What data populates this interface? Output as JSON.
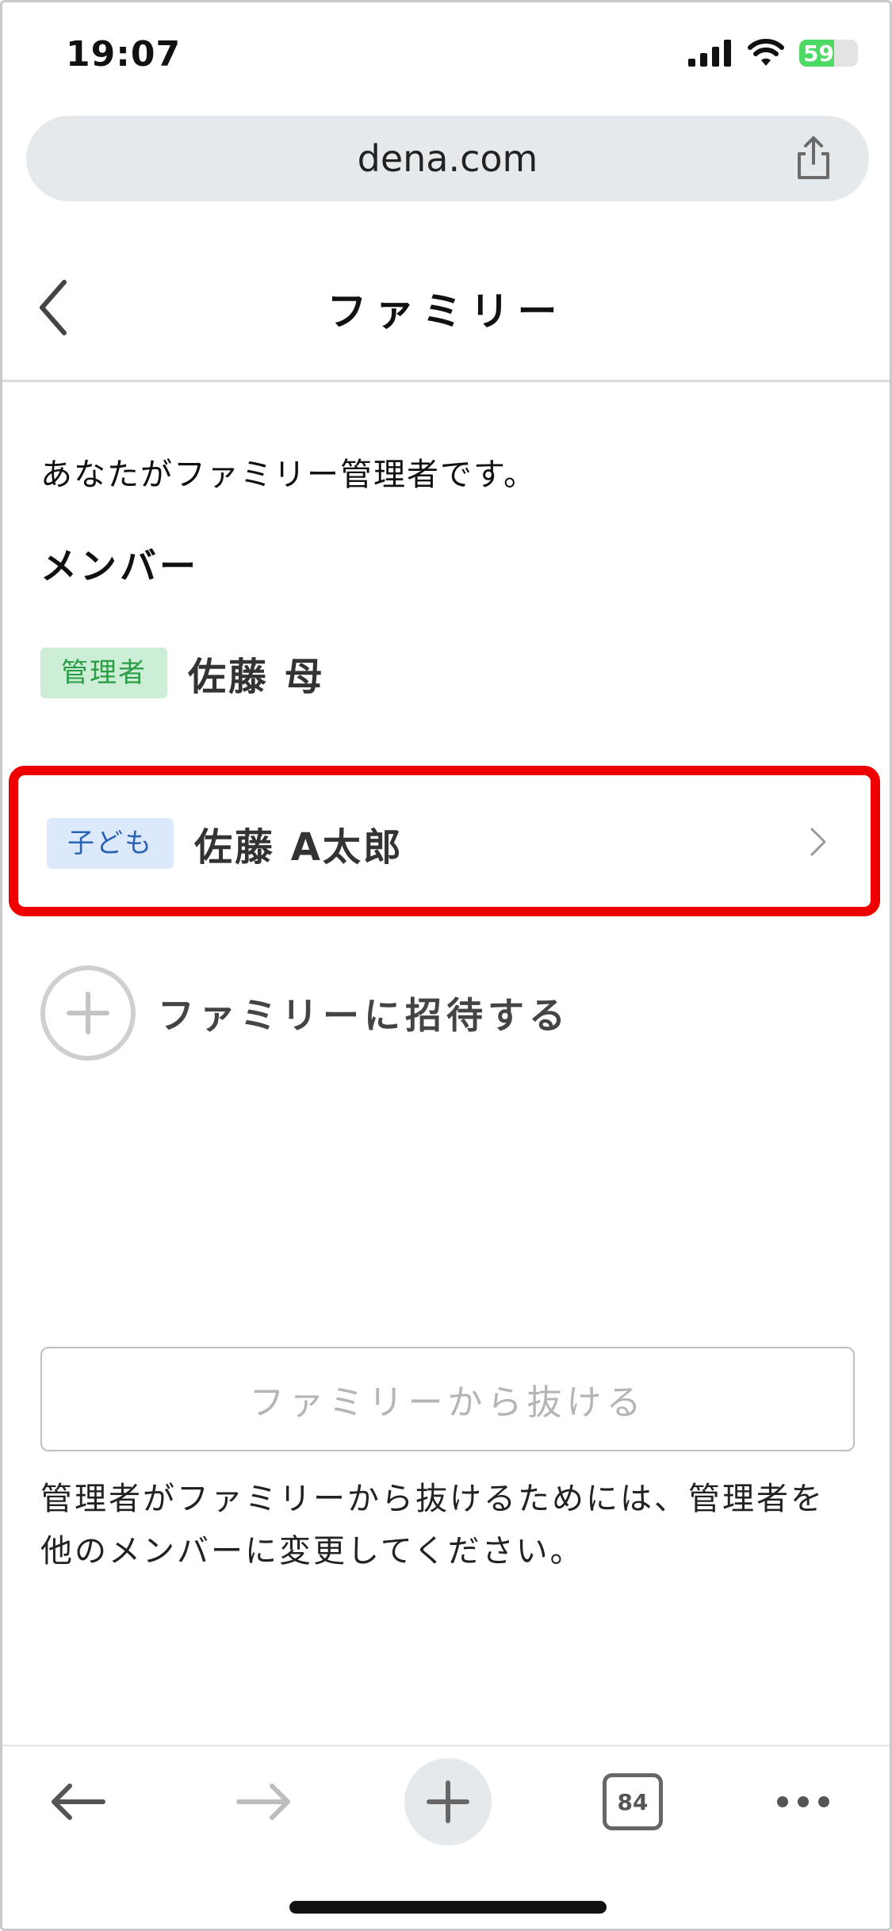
{
  "status_bar": {
    "time": "19:07",
    "battery": "59",
    "battery_level": 0.59
  },
  "browser": {
    "url": "dena.com",
    "tab_count": "84"
  },
  "header": {
    "title": "ファミリー"
  },
  "content": {
    "admin_notice": "あなたがファミリー管理者です。",
    "members_heading": "メンバー",
    "members": [
      {
        "role": "管理者",
        "name": "佐藤 母"
      },
      {
        "role": "子ども",
        "name": "佐藤 A太郎"
      }
    ],
    "invite_label": "ファミリーに招待する",
    "leave_button": "ファミリーから抜ける",
    "leave_note": "管理者がファミリーから抜けるためには、管理者を他のメンバーに変更してください。"
  },
  "colors": {
    "highlight": "#ee0000",
    "admin_badge_bg": "#cdeed6",
    "admin_badge_text": "#2a9d45",
    "child_badge_bg": "#dce9fb",
    "child_badge_text": "#2a63b6"
  },
  "icons": [
    "signal-icon",
    "wifi-icon",
    "battery-icon",
    "share-icon",
    "back-chevron-icon",
    "chevron-right-icon",
    "plus-icon",
    "arrow-left-icon",
    "arrow-right-icon",
    "tabs-icon",
    "more-icon"
  ]
}
